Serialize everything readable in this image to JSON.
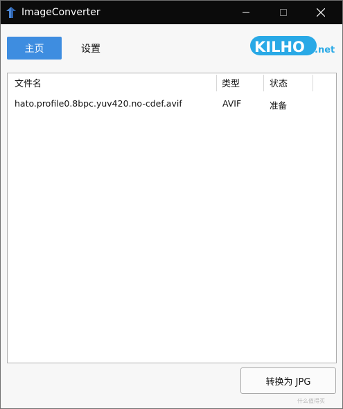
{
  "window": {
    "title": "ImageConverter"
  },
  "icons": {
    "app": "app-arrow-icon",
    "minimize": "minimize-icon",
    "maximize": "maximize-icon",
    "close": "close-icon"
  },
  "nav": {
    "home_label": "主页",
    "settings_label": "设置"
  },
  "logo": {
    "main": "KILHO",
    "suffix": ".net",
    "color": "#29a9e6"
  },
  "colors": {
    "accent": "#3e8de0",
    "titlebar": "#0b0b0b"
  },
  "file_list": {
    "columns": [
      "文件名",
      "类型",
      "状态"
    ],
    "rows": [
      {
        "name": "hato.profile0.8bpc.yuv420.no-cdef.avif",
        "type": "AVIF",
        "status": "准备"
      }
    ]
  },
  "actions": {
    "convert_label": "转换为 JPG"
  },
  "watermark": {
    "text": "什么值得买"
  }
}
